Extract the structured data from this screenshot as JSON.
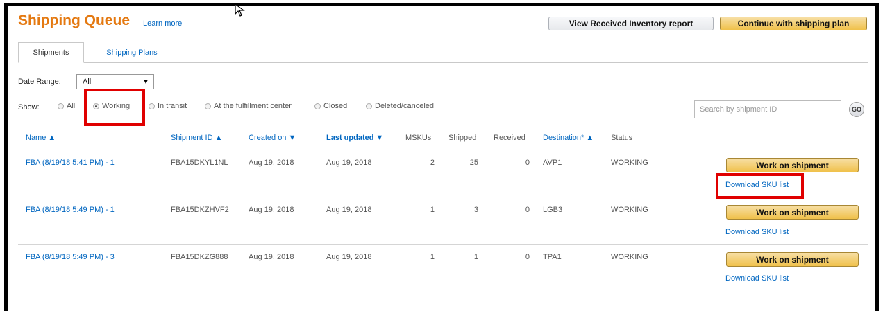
{
  "header": {
    "title": "Shipping Queue",
    "learn_more": "Learn more",
    "received_inventory_button": "View Received Inventory report",
    "continue_button": "Continue with shipping plan"
  },
  "tabs": [
    {
      "label": "Shipments",
      "active": true
    },
    {
      "label": "Shipping Plans",
      "active": false
    }
  ],
  "filters": {
    "date_range_label": "Date Range:",
    "date_range_value": "All",
    "show_label": "Show:",
    "options": [
      "All",
      "Working",
      "In transit",
      "At the fulfillment center",
      "Closed",
      "Deleted/canceled"
    ],
    "selected": "Working",
    "search_placeholder": "Search by shipment ID",
    "go_label": "GO"
  },
  "table": {
    "columns": {
      "name": "Name ▲",
      "shipment_id": "Shipment ID ▲",
      "created_on": "Created on ▼",
      "last_updated": "Last updated ▼",
      "mskus": "MSKUs",
      "shipped": "Shipped",
      "received": "Received",
      "destination": "Destination* ▲",
      "status": "Status"
    },
    "rows": [
      {
        "name": "FBA (8/19/18 5:41 PM) - 1",
        "shipment_id": "FBA15DKYL1NL",
        "created_on": "Aug 19, 2018",
        "last_updated": "Aug 19, 2018",
        "mskus": "2",
        "shipped": "25",
        "received": "0",
        "destination": "AVP1",
        "status": "WORKING",
        "action": "Work on shipment",
        "download": "Download SKU list"
      },
      {
        "name": "FBA (8/19/18 5:49 PM) - 1",
        "shipment_id": "FBA15DKZHVF2",
        "created_on": "Aug 19, 2018",
        "last_updated": "Aug 19, 2018",
        "mskus": "1",
        "shipped": "3",
        "received": "0",
        "destination": "LGB3",
        "status": "WORKING",
        "action": "Work on shipment",
        "download": "Download SKU list"
      },
      {
        "name": "FBA (8/19/18 5:49 PM) - 3",
        "shipment_id": "FBA15DKZG888",
        "created_on": "Aug 19, 2018",
        "last_updated": "Aug 19, 2018",
        "mskus": "1",
        "shipped": "1",
        "received": "0",
        "destination": "TPA1",
        "status": "WORKING",
        "action": "Work on shipment",
        "download": "Download SKU list"
      }
    ]
  },
  "colors": {
    "title_orange": "#e47911",
    "link_blue": "#0066c0",
    "button_gold": "#f0c14b",
    "highlight_red": "#e00000"
  }
}
